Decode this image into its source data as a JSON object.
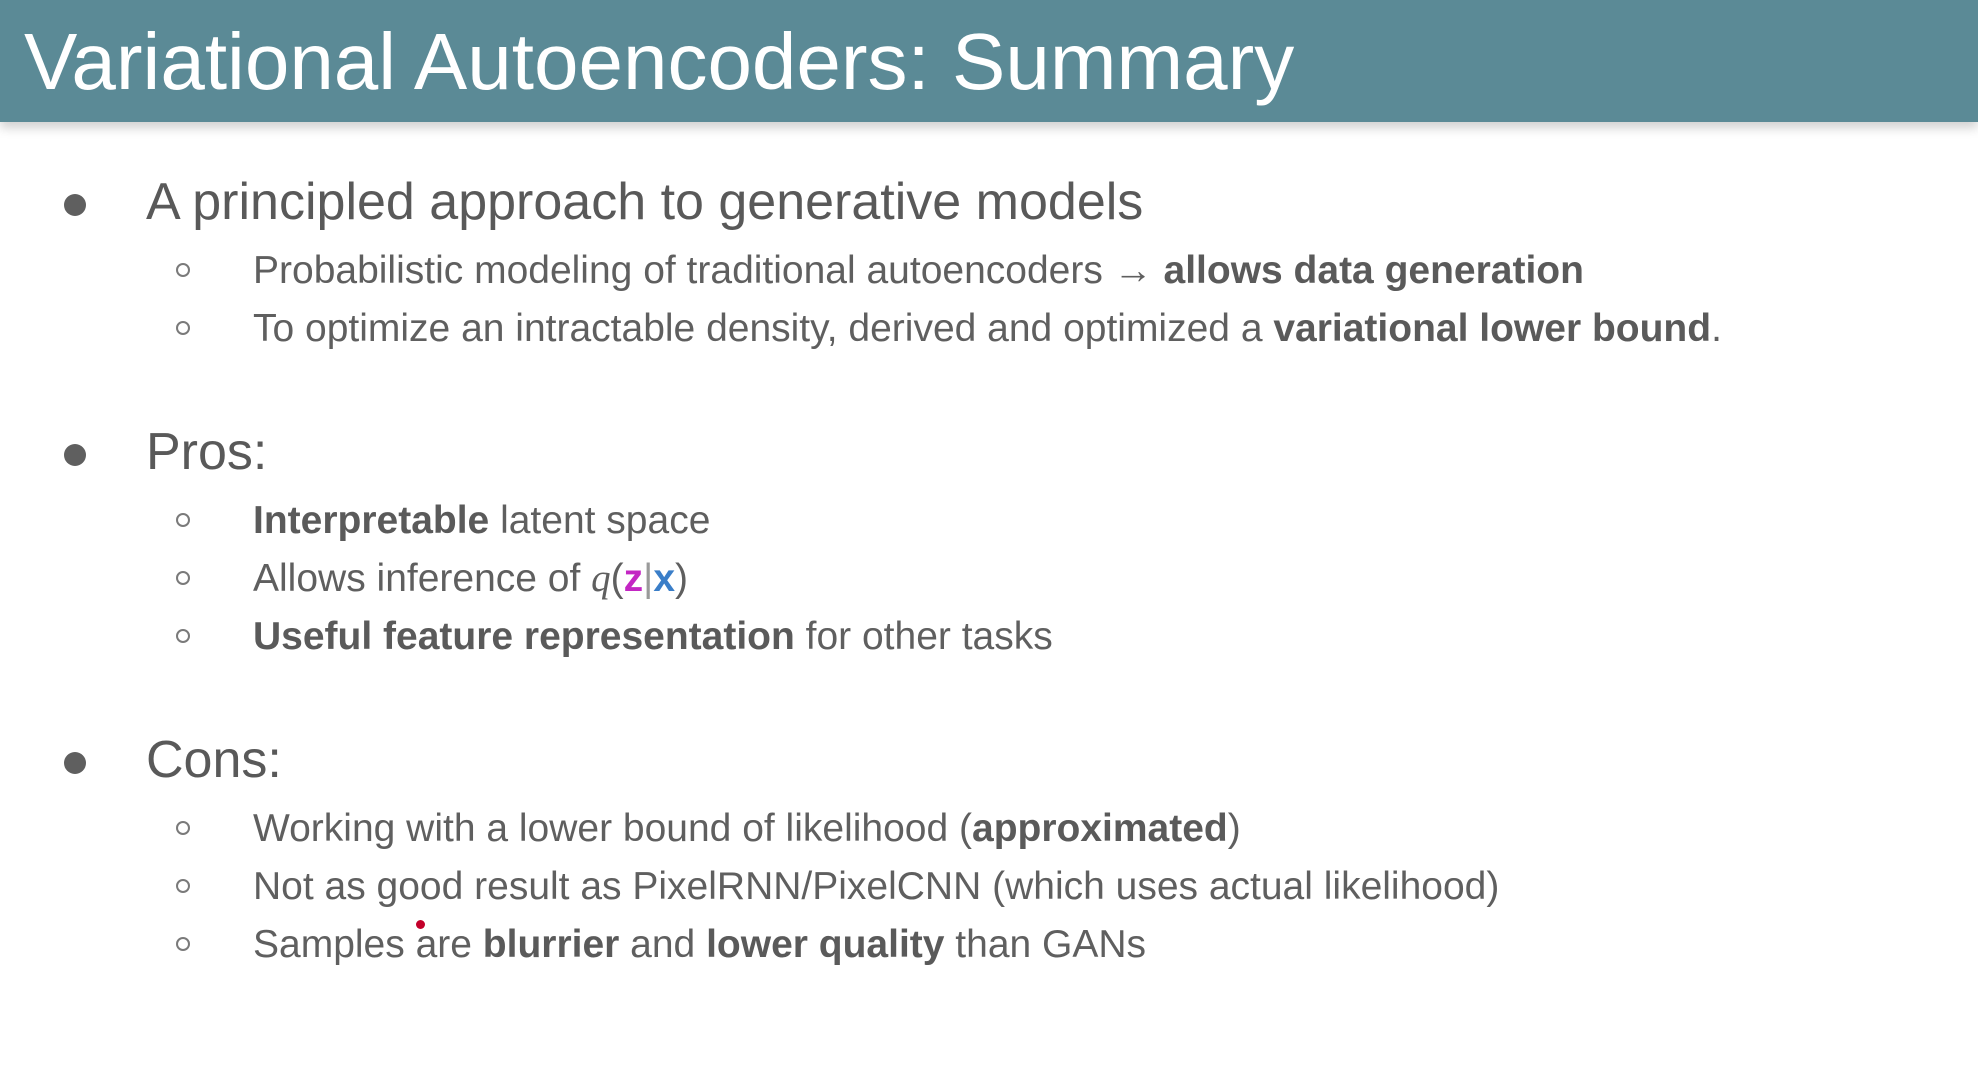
{
  "title": "Variational Autoencoders: Summary",
  "sections": [
    {
      "heading": "A principled approach to generative models",
      "items": [
        {
          "plain1": "Probabilistic modeling of traditional autoencoders → ",
          "bold1": "allows data generation"
        },
        {
          "plain1": "To optimize an intractable density, derived and optimized a ",
          "bold1": "variational lower bound",
          "plain2": "."
        }
      ]
    },
    {
      "heading": "Pros:",
      "items": [
        {
          "bold1": "Interpretable",
          "plain1": " latent space"
        },
        {
          "plain1": "Allows inference of ",
          "math_q": "q",
          "math_open": "(",
          "math_z": "z",
          "math_bar": "|",
          "math_x": "x",
          "math_close": ")"
        },
        {
          "bold1": "Useful feature representation",
          "plain1": " for other tasks"
        }
      ]
    },
    {
      "heading": "Cons:",
      "items": [
        {
          "plain1": "Working with a lower bound of likelihood (",
          "bold1": "approximated",
          "plain2": ")"
        },
        {
          "plain1": "Not as good result as PixelRNN/PixelCNN (which uses actual likelihood)"
        },
        {
          "plain1": "Samples are ",
          "bold1": "blurrier",
          "plain2": " and ",
          "bold2": "lower quality",
          "plain3": " than GANs"
        }
      ]
    }
  ],
  "colors": {
    "title_bar": "#5b8a96",
    "title_text": "#ffffff",
    "body_text": "#5f5f5f",
    "math_z": "#c326c3",
    "math_x": "#3a7ec8",
    "pointer_dot": "#c3002a"
  }
}
